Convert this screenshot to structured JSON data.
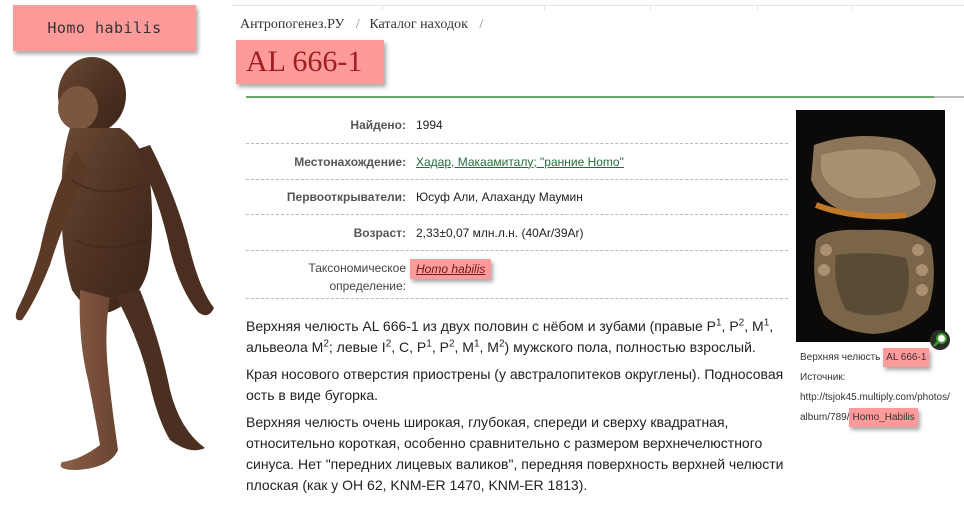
{
  "figure": {
    "label": "Homo habilis"
  },
  "breadcrumb": {
    "home": "Антропогенез.РУ",
    "catalog": "Каталог находок",
    "separator": "/"
  },
  "page_title": "AL 666-1",
  "info": {
    "found_key": "Найдено:",
    "found_val": "1994",
    "location_key": "Местонахождение:",
    "location_val": "Хадар, Макаамиталу; \"ранние Homo\"",
    "discoverers_key": "Первооткрыватели:",
    "discoverers_val": "Юсуф Али, Алахандy Маумин",
    "age_key": "Возраст:",
    "age_val": "2,33±0,07 млн.л.н. (40Ar/39Ar)",
    "taxon_key_line1": "Таксономическое",
    "taxon_key_line2": "определение:",
    "taxon_val": "Homo habilis"
  },
  "description": {
    "p1_text": "Верхняя челюсть AL 666-1 из двух половин с нёбом и зубами (правые P",
    "p1_rest1": ", P",
    "p1_rest2": ", M",
    "p1_rest3": ", альвеола M",
    "p1_rest4": "; левые I",
    "p1_rest5": ", C, P",
    "p1_rest6": ", P",
    "p1_rest7": ", M",
    "p1_rest8": ", M",
    "p1_rest9": ") мужского пола, полностью взрослый.",
    "sup1": "1",
    "sup2": "2",
    "sup3": "1",
    "sup4": "2",
    "sup5": "2",
    "sup6": "1",
    "sup7": "2",
    "sup8": "1",
    "sup9": "2",
    "p2": "Края носового отверстия приострены (у австралопитеков округлены). Подносовая ость в виде бугорка.",
    "p3": "Верхняя челюсть очень широкая, глубокая, спереди и сверху квадратная, относительно короткая, особенно сравнительно с размером верхнечелюстного синуса. Нет \"передних лицевых валиков\", передняя поверхность верхней челюсти плоская (как у OH 62, KNM-ER 1470, KNM-ER 1813)."
  },
  "photo": {
    "caption_prefix": "Верхняя челюсть",
    "caption_id": "AL 666-1",
    "source_label": "Источник:",
    "source_url_line1": "http://tsjok45.multiply.com/photos/",
    "source_url_line2_prefix": "album/789/",
    "source_url_line2_hl": "Homo_Habilis"
  },
  "icons": {
    "zoom": "zoom-icon"
  },
  "colors": {
    "highlight": "#ff9a9a",
    "title": "#a02020",
    "accent_rule": "#6aa86a",
    "link": "#236d3a"
  }
}
